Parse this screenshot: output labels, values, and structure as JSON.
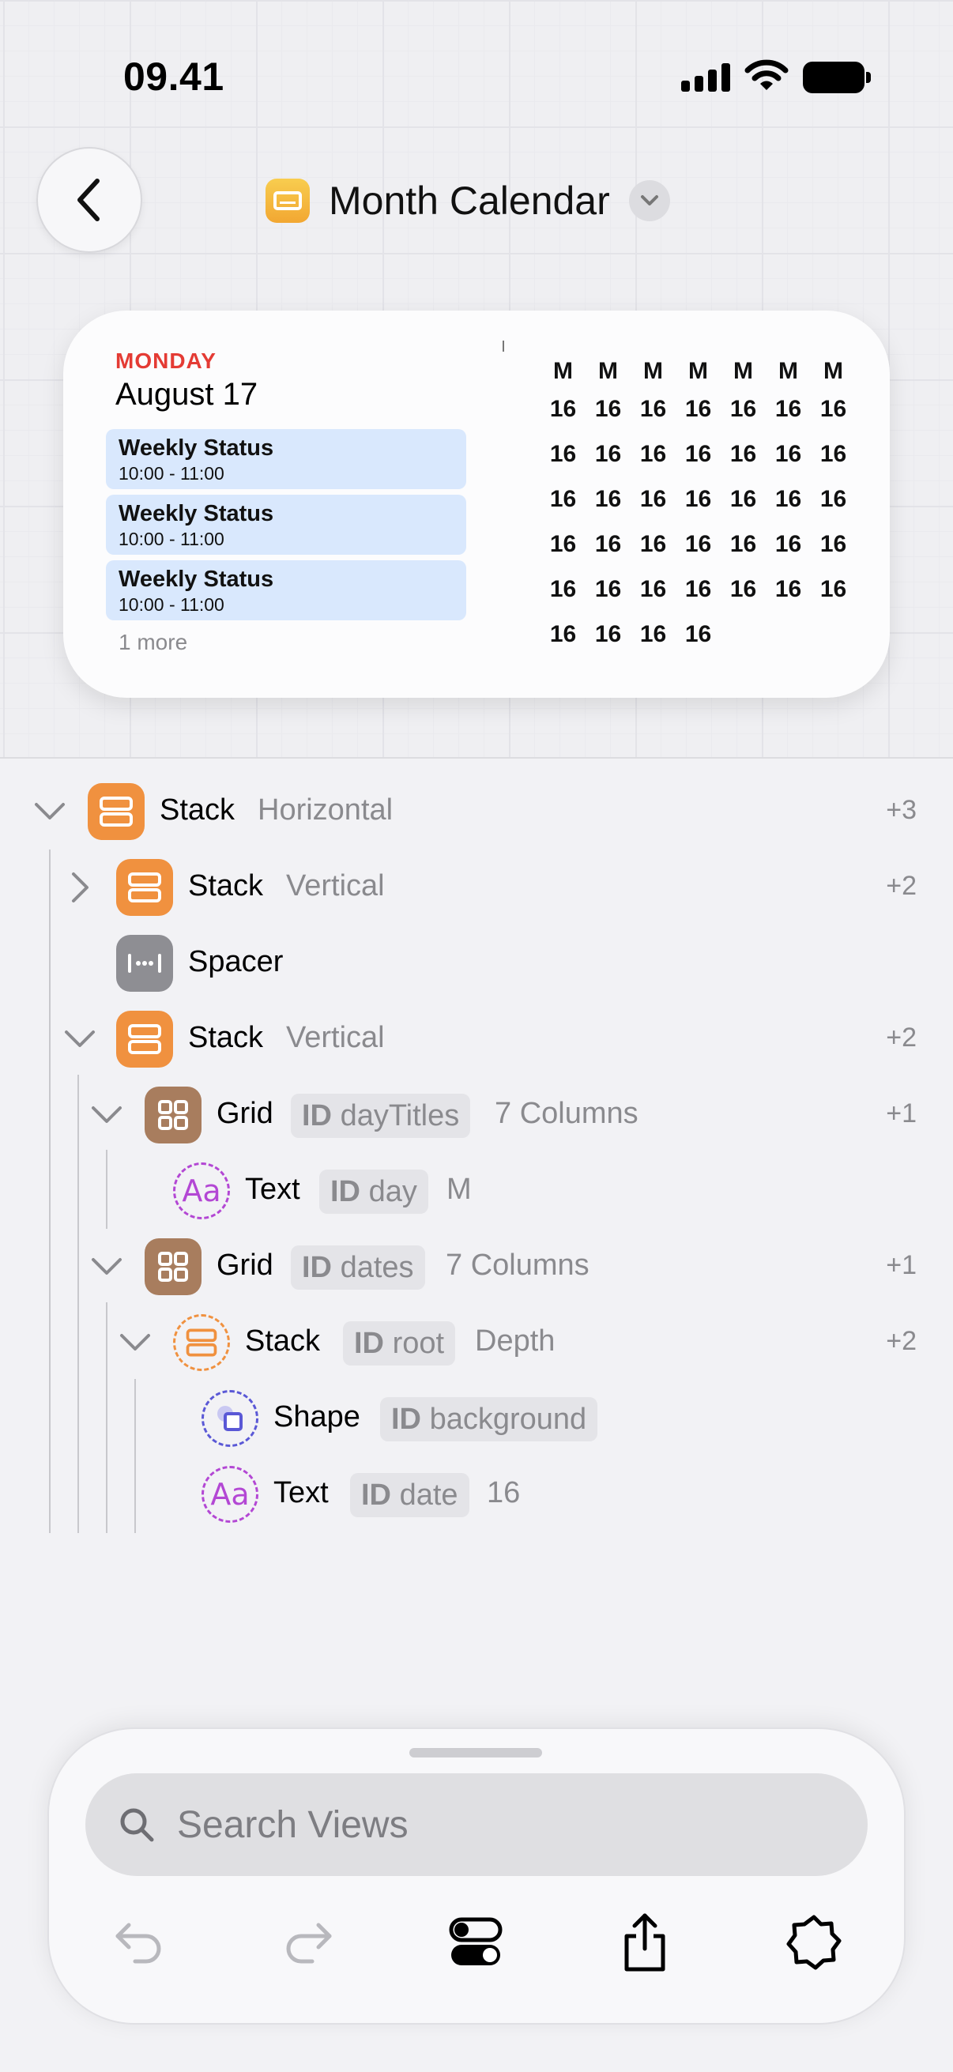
{
  "status_bar": {
    "time": "09.41"
  },
  "header": {
    "title": "Month Calendar"
  },
  "widget": {
    "weekday": "MONDAY",
    "date": "August 17",
    "events": [
      {
        "title": "Weekly Status",
        "time": "10:00 - 11:00"
      },
      {
        "title": "Weekly Status",
        "time": "10:00 - 11:00"
      },
      {
        "title": "Weekly Status",
        "time": "10:00 - 11:00"
      }
    ],
    "more": "1 more",
    "day_titles": [
      "M",
      "M",
      "M",
      "M",
      "M",
      "M",
      "M"
    ],
    "dates": [
      [
        "16",
        "16",
        "16",
        "16",
        "16",
        "16",
        "16"
      ],
      [
        "16",
        "16",
        "16",
        "16",
        "16",
        "16",
        "16"
      ],
      [
        "16",
        "16",
        "16",
        "16",
        "16",
        "16",
        "16"
      ],
      [
        "16",
        "16",
        "16",
        "16",
        "16",
        "16",
        "16"
      ],
      [
        "16",
        "16",
        "16",
        "16",
        "16",
        "16",
        "16"
      ],
      [
        "16",
        "16",
        "16",
        "16"
      ]
    ]
  },
  "tree": [
    {
      "name": "Stack",
      "sub": "Horizontal",
      "count": "+3"
    },
    {
      "name": "Stack",
      "sub": "Vertical",
      "count": "+2"
    },
    {
      "name": "Spacer"
    },
    {
      "name": "Stack",
      "sub": "Vertical",
      "count": "+2"
    },
    {
      "name": "Grid",
      "id_label": "ID",
      "id": "dayTitles",
      "sub": "7 Columns",
      "count": "+1"
    },
    {
      "name": "Text",
      "id_label": "ID",
      "id": "day",
      "sub": "M"
    },
    {
      "name": "Grid",
      "id_label": "ID",
      "id": "dates",
      "sub": "7 Columns",
      "count": "+1"
    },
    {
      "name": "Stack",
      "id_label": "ID",
      "id": "root",
      "sub": "Depth",
      "count": "+2"
    },
    {
      "name": "Shape",
      "id_label": "ID",
      "id": "background"
    },
    {
      "name": "Text",
      "id_label": "ID",
      "id": "date",
      "sub": "16"
    }
  ],
  "search": {
    "placeholder": "Search Views"
  },
  "icons": {
    "back": "chevron-left-icon",
    "app": "widget-icon",
    "stack": "stack-icon",
    "spacer": "spacer-icon",
    "grid": "grid-icon",
    "text": "text-icon",
    "shape": "shape-icon",
    "undo": "undo-icon",
    "redo": "redo-icon",
    "toggles": "toggles-icon",
    "share": "share-icon",
    "settings": "badge-icon"
  },
  "colors": {
    "stack": "#f0913f",
    "grid": "#a87d5e",
    "spacer": "#8e8e93",
    "text": "#b347d4",
    "shape": "#5a58d6",
    "weekday": "#e43b34",
    "event": "#d9e8fd"
  }
}
